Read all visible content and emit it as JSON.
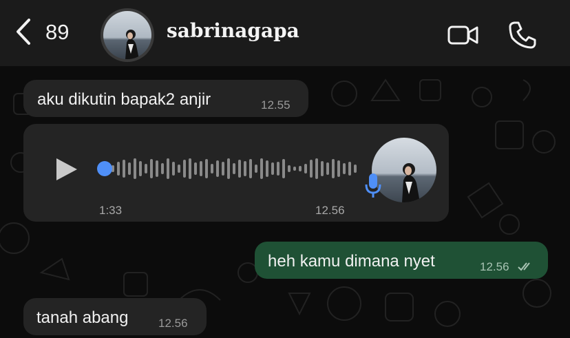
{
  "header": {
    "back_count": "89",
    "contact_name": "sabrinagapa"
  },
  "messages": [
    {
      "direction": "in",
      "type": "text",
      "text": "aku dikutin bapak2 anjir",
      "time": "12.55"
    },
    {
      "direction": "in",
      "type": "voice",
      "duration": "1:33",
      "time": "12.56",
      "progress": 0
    },
    {
      "direction": "out",
      "type": "text",
      "text": "heh kamu dimana nyet",
      "time": "12.56",
      "status": "read"
    },
    {
      "direction": "in",
      "type": "text",
      "text": "tanah abang",
      "time": "12.56"
    }
  ],
  "colors": {
    "header_bg": "#1b1b1b",
    "incoming_bubble": "#242424",
    "outgoing_bubble": "#1f5135",
    "accent_blue": "#4f8ff7"
  },
  "icons": {
    "back": "chevron-left-icon",
    "video": "video-camera-icon",
    "call": "phone-icon",
    "play": "play-icon",
    "mic": "microphone-icon",
    "read_status": "double-check-icon"
  }
}
